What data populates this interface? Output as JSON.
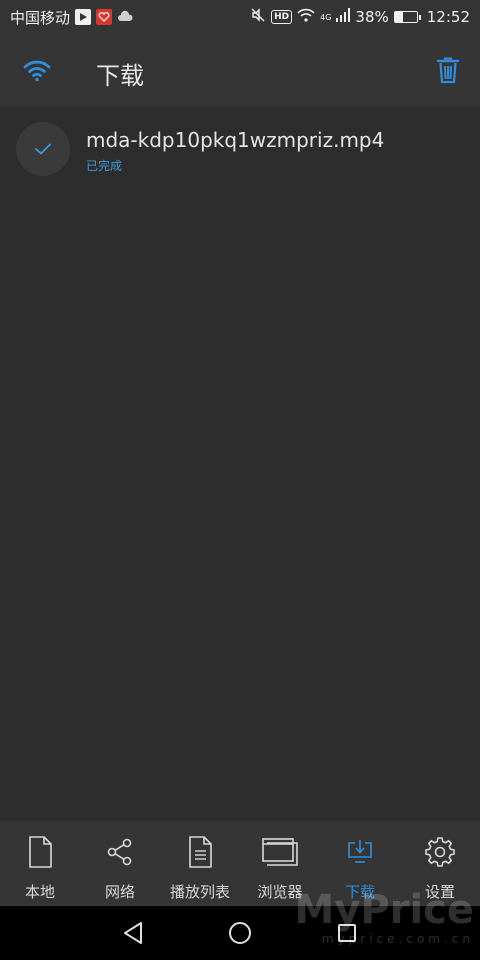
{
  "status_bar": {
    "carrier": "中国移动",
    "network_badge": "HD",
    "signal_label": "4G",
    "battery": "38%",
    "battery_level": 0.38,
    "time": "12:52"
  },
  "header": {
    "title": "下载",
    "wifi_icon": "wifi-icon",
    "trash_icon": "trash-icon"
  },
  "downloads": [
    {
      "file_name": "mda-kdp10pkq1wzmpriz.mp4",
      "status": "已完成"
    }
  ],
  "tabs": [
    {
      "label": "本地",
      "icon": "file-icon"
    },
    {
      "label": "网络",
      "icon": "share-icon"
    },
    {
      "label": "播放列表",
      "icon": "document-icon"
    },
    {
      "label": "浏览器",
      "icon": "browser-window-icon"
    },
    {
      "label": "下载",
      "icon": "download-icon",
      "active": true
    },
    {
      "label": "设置",
      "icon": "gear-icon"
    }
  ],
  "watermark": {
    "brand": "MyPrice",
    "url": "myprice.com.cn"
  },
  "colors": {
    "accent": "#2f8fdc",
    "background": "#2d2d2d",
    "bar": "#353535"
  }
}
